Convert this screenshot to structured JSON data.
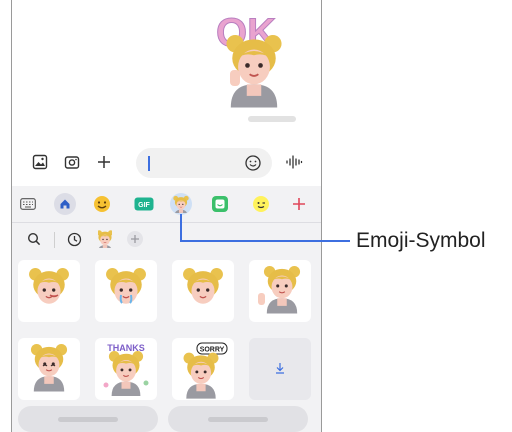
{
  "colors": {
    "accent": "#3d6fe0",
    "callout_line": "#3d6fe0",
    "panel_bg": "#f2f2f4",
    "selected_tab_bg": "#cfe0f5",
    "add_plus": "#e0475a"
  },
  "chat": {
    "sent_sticker": "ok-avatar-sticker",
    "sent_sticker_text": "OK"
  },
  "input_bar": {
    "icons": [
      "gallery-icon",
      "camera-icon",
      "plus-icon",
      "emoji-icon",
      "voice-icon"
    ]
  },
  "emoji_panel": {
    "tabs": [
      "keyboard-icon",
      "home-icon",
      "emoji-icon",
      "gif-icon",
      "ar-emoji-icon",
      "sticker-icon",
      "bitmoji-icon",
      "add-icon"
    ],
    "selected_tab": "ar-emoji-icon",
    "filters": [
      "search-icon",
      "recent-icon",
      "avatar-icon",
      "add-avatar-icon"
    ],
    "stickers": [
      "avatar-wink-sticker",
      "avatar-crying-sticker",
      "avatar-smirk-sticker",
      "avatar-wave-sticker",
      "avatar-laugh-sticker",
      "avatar-thanks-sticker",
      "avatar-sorry-sticker",
      "download-more-stickers"
    ],
    "sticker_texts": {
      "thanks": "THANKS",
      "sorry": "SORRY"
    }
  },
  "callout": {
    "label": "Emoji-Symbol"
  }
}
